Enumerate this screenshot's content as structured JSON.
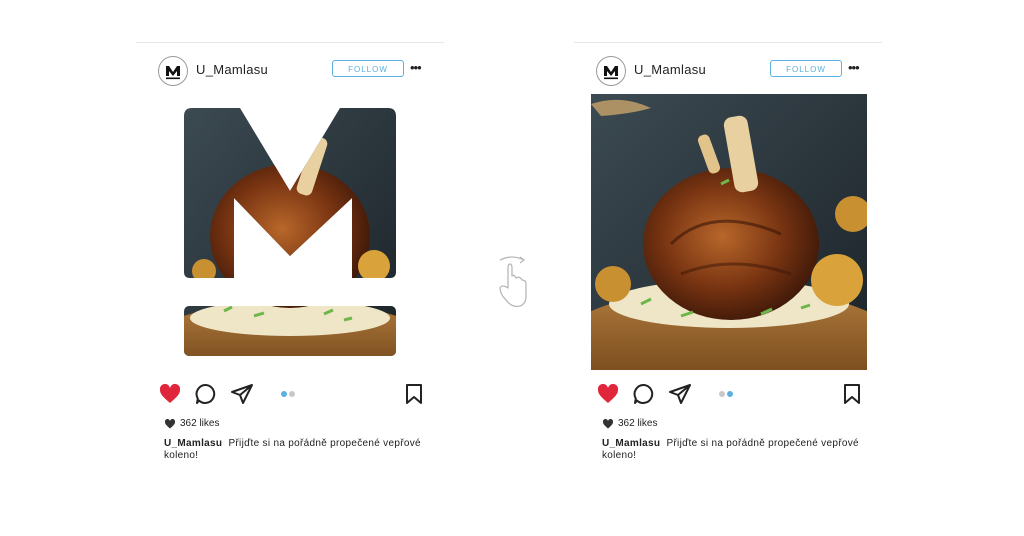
{
  "colors": {
    "accent": "#5ab0e0",
    "like_red": "#e0263a",
    "text": "#222222"
  },
  "posts": [
    {
      "username": "U_Mamlasu",
      "follow_label": "FOLLOW",
      "more_label": "•••",
      "likes_text": "362 likes",
      "caption_user": "U_Mamlasu",
      "caption_text": "Přijďte si na pořádně propečené vepřové koleno!",
      "icons": [
        "heart-icon",
        "comment-icon",
        "share-icon",
        "bookmark-icon"
      ],
      "carousel_active_dot": 0
    },
    {
      "username": "U_Mamlasu",
      "follow_label": "FOLLOW",
      "more_label": "•••",
      "likes_text": "362 likes",
      "caption_user": "U_Mamlasu",
      "caption_text": "Přijďte si na pořádně propečené vepřové koleno!",
      "icons": [
        "heart-icon",
        "comment-icon",
        "share-icon",
        "bookmark-icon"
      ],
      "carousel_active_dot": 1
    }
  ],
  "swipe_hint_icon": "swipe-hand-icon"
}
